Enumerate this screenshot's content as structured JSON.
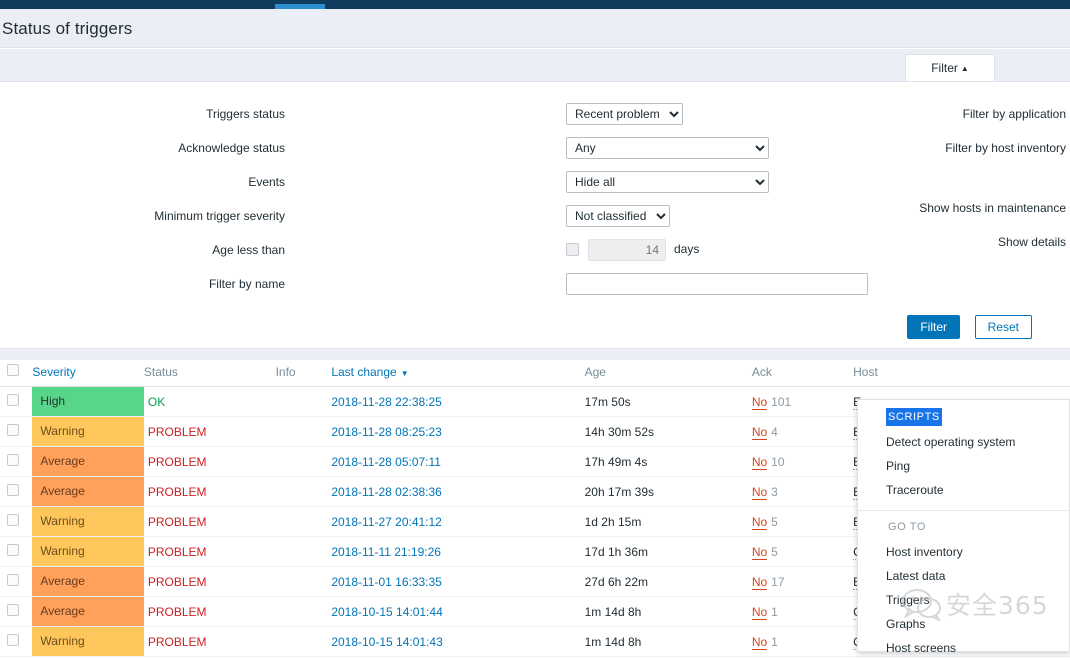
{
  "topbar": {
    "active_tab": "monitoring-tab"
  },
  "header": {
    "title": "Status of triggers"
  },
  "filter_tab": {
    "label": "Filter",
    "caret": "▲"
  },
  "filter": {
    "fields": [
      {
        "label": "Triggers status",
        "value": "Recent problem"
      },
      {
        "label": "Acknowledge status",
        "value": "Any"
      },
      {
        "label": "Events",
        "value": "Hide all"
      },
      {
        "label": "Minimum trigger severity",
        "value": "Not classified"
      }
    ],
    "age": {
      "label": "Age less than",
      "placeholder": "14",
      "unit": "days",
      "checked": false
    },
    "name": {
      "label": "Filter by name",
      "value": "",
      "placeholder": ""
    },
    "right_links": [
      "Filter by application",
      "Filter by host inventory",
      "Show hosts in maintenance",
      "Show details"
    ],
    "buttons": {
      "apply": "Filter",
      "reset": "Reset"
    }
  },
  "table": {
    "columns": [
      {
        "key": "chk",
        "label": "",
        "sortable": false
      },
      {
        "key": "severity",
        "label": "Severity",
        "sortable": true
      },
      {
        "key": "status",
        "label": "Status",
        "sortable": false
      },
      {
        "key": "info",
        "label": "Info",
        "sortable": false
      },
      {
        "key": "last_change",
        "label": "Last change",
        "sortable": true,
        "sort_arrow": "▼"
      },
      {
        "key": "age",
        "label": "Age",
        "sortable": false
      },
      {
        "key": "ack",
        "label": "Ack",
        "sortable": false
      },
      {
        "key": "host",
        "label": "Host",
        "sortable": false
      }
    ],
    "rows": [
      {
        "severity": "High",
        "status": "OK",
        "info": "",
        "last_change": "2018-11-28 22:38:25",
        "age": "17m 50s",
        "ack": "No",
        "ack_count": "101",
        "host": "E"
      },
      {
        "severity": "Warning",
        "status": "PROBLEM",
        "info": "",
        "last_change": "2018-11-28 08:25:23",
        "age": "14h 30m 52s",
        "ack": "No",
        "ack_count": "4",
        "host": "E"
      },
      {
        "severity": "Average",
        "status": "PROBLEM",
        "info": "",
        "last_change": "2018-11-28 05:07:11",
        "age": "17h 49m 4s",
        "ack": "No",
        "ack_count": "10",
        "host": "E"
      },
      {
        "severity": "Average",
        "status": "PROBLEM",
        "info": "",
        "last_change": "2018-11-28 02:38:36",
        "age": "20h 17m 39s",
        "ack": "No",
        "ack_count": "3",
        "host": "E"
      },
      {
        "severity": "Warning",
        "status": "PROBLEM",
        "info": "",
        "last_change": "2018-11-27 20:41:12",
        "age": "1d 2h 15m",
        "ack": "No",
        "ack_count": "5",
        "host": "E"
      },
      {
        "severity": "Warning",
        "status": "PROBLEM",
        "info": "",
        "last_change": "2018-11-11 21:19:26",
        "age": "17d 1h 36m",
        "ack": "No",
        "ack_count": "5",
        "host": "C"
      },
      {
        "severity": "Average",
        "status": "PROBLEM",
        "info": "",
        "last_change": "2018-11-01 16:33:35",
        "age": "27d 6h 22m",
        "ack": "No",
        "ack_count": "17",
        "host": "E"
      },
      {
        "severity": "Average",
        "status": "PROBLEM",
        "info": "",
        "last_change": "2018-10-15 14:01:44",
        "age": "1m 14d 8h",
        "ack": "No",
        "ack_count": "1",
        "host": "C"
      },
      {
        "severity": "Warning",
        "status": "PROBLEM",
        "info": "",
        "last_change": "2018-10-15 14:01:43",
        "age": "1m 14d 8h",
        "ack": "No",
        "ack_count": "1",
        "host": "C"
      }
    ]
  },
  "context_menu": {
    "scripts_title": "SCRIPTS",
    "scripts_items": [
      "Detect operating system",
      "Ping",
      "Traceroute"
    ],
    "goto_title": "GO TO",
    "goto_items": [
      "Host inventory",
      "Latest data",
      "Triggers",
      "Graphs",
      "Host screens"
    ]
  },
  "watermark": {
    "text": "安全365"
  },
  "colors": {
    "topbar": "#0f3b5c",
    "accent": "#0275b8",
    "severity_high": "#57d68a",
    "severity_warning": "#ffc75b",
    "severity_average": "#ffa15b",
    "status_ok": "#0b9a4a",
    "status_problem": "#cc2222",
    "ack_no": "#d2451e",
    "menu_selected": "#1874e8"
  }
}
